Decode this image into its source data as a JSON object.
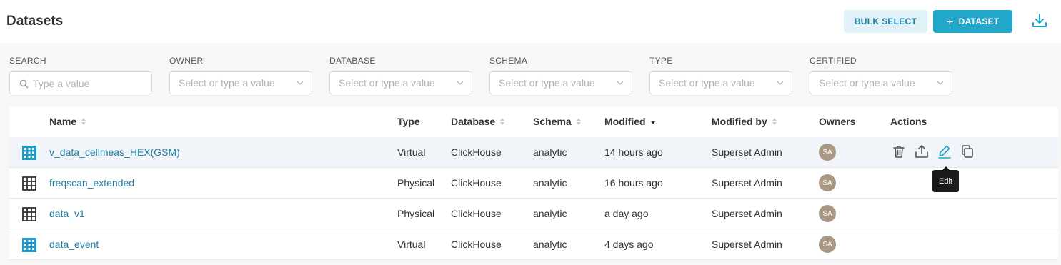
{
  "header": {
    "title": "Datasets",
    "bulk_select_label": "BULK SELECT",
    "add_dataset_label": "DATASET",
    "add_dataset_plus": "+"
  },
  "filters": {
    "search": {
      "label": "SEARCH",
      "placeholder": "Type a value"
    },
    "owner": {
      "label": "OWNER",
      "placeholder": "Select or type a value"
    },
    "database": {
      "label": "DATABASE",
      "placeholder": "Select or type a value"
    },
    "schema": {
      "label": "SCHEMA",
      "placeholder": "Select or type a value"
    },
    "type": {
      "label": "TYPE",
      "placeholder": "Select or type a value"
    },
    "certified": {
      "label": "CERTIFIED",
      "placeholder": "Select or type a value"
    }
  },
  "table": {
    "columns": {
      "name": "Name",
      "type": "Type",
      "database": "Database",
      "schema": "Schema",
      "modified": "Modified",
      "modified_by": "Modified by",
      "owners": "Owners",
      "actions": "Actions"
    },
    "rows": [
      {
        "name": "v_data_cellmeas_HEX(GSM)",
        "type": "Virtual",
        "database": "ClickHouse",
        "schema": "analytic",
        "modified": "14 hours ago",
        "modified_by": "Superset Admin",
        "owner_initials": "SA",
        "icon": "virtual-dataset-icon"
      },
      {
        "name": "freqscan_extended",
        "type": "Physical",
        "database": "ClickHouse",
        "schema": "analytic",
        "modified": "16 hours ago",
        "modified_by": "Superset Admin",
        "owner_initials": "SA",
        "icon": "physical-dataset-icon"
      },
      {
        "name": "data_v1",
        "type": "Physical",
        "database": "ClickHouse",
        "schema": "analytic",
        "modified": "a day ago",
        "modified_by": "Superset Admin",
        "owner_initials": "SA",
        "icon": "physical-dataset-icon"
      },
      {
        "name": "data_event",
        "type": "Virtual",
        "database": "ClickHouse",
        "schema": "analytic",
        "modified": "4 days ago",
        "modified_by": "Superset Admin",
        "owner_initials": "SA",
        "icon": "virtual-dataset-icon"
      }
    ]
  },
  "tooltip": {
    "text": "Edit"
  },
  "colors": {
    "accent": "#20a7c9",
    "link": "#1f7fa3",
    "virtual_icon": "#1e9bc4",
    "avatar": "#a89884"
  }
}
